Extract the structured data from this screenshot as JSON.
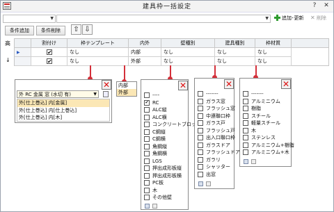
{
  "window": {
    "title": "建具枠一括設定",
    "help": "?",
    "close": "✕"
  },
  "toolbar": {
    "combo1_value": "",
    "combo2_value": "",
    "add_update_label": "追加･更新",
    "delete_label": "削除",
    "add_condition_label": "条件追加",
    "delete_condition_label": "条件削除"
  },
  "grid": {
    "left_labels": [
      "高",
      "↓"
    ],
    "headers": [
      "割付け",
      "枠テンプレート",
      "内外",
      "壁種別",
      "建具種別",
      "枠材質"
    ],
    "rows": [
      {
        "checked": true,
        "template": "なし",
        "inout": "内部",
        "wall": "なし",
        "door": "なし",
        "material": "なし"
      },
      {
        "checked": true,
        "template": "なし",
        "inout": "外部",
        "wall": "なし",
        "door": "なし",
        "material": "なし"
      }
    ]
  },
  "template_panel": {
    "close": "✕",
    "selected": "外 RC 金属 窓 (水切 有)",
    "items": [
      "外[仕上巻込] 内[金属]",
      "外[仕上巻込] 内[仕上巻込]",
      "外[仕上巻込] 内[木]"
    ]
  },
  "inout_panel": {
    "items": [
      "内部",
      "外部"
    ]
  },
  "wall_panel": {
    "close": "✕",
    "items": [
      {
        "label": "----",
        "checked": false
      },
      {
        "label": "RC",
        "checked": true
      },
      {
        "label": "ALC縦",
        "checked": false
      },
      {
        "label": "ALC横",
        "checked": false
      },
      {
        "label": "コンクリートブロック",
        "checked": false
      },
      {
        "label": "C鋼縦",
        "checked": false
      },
      {
        "label": "C鋼横",
        "checked": false
      },
      {
        "label": "角鋼縦",
        "checked": false
      },
      {
        "label": "角鋼横",
        "checked": false
      },
      {
        "label": "LGS",
        "checked": false
      },
      {
        "label": "押出成形板縦",
        "checked": false
      },
      {
        "label": "押出成形板横",
        "checked": false
      },
      {
        "label": "PC板",
        "checked": false
      },
      {
        "label": "木",
        "checked": false
      },
      {
        "label": "その他壁",
        "checked": false
      }
    ]
  },
  "door_panel": {
    "close": "✕",
    "items": [
      "-------",
      "ガラス窓",
      "フラッシュ窓",
      "中連聯口枠",
      "ガラス戸",
      "フラッシュ戸",
      "出入口聯口枠",
      "ガラスドア",
      "フラッシュドア",
      "ガラリ",
      "シャッター",
      "出窓"
    ]
  },
  "material_panel": {
    "close": "✕",
    "items": [
      "-------",
      "アルミニウム",
      "樹脂",
      "スチール",
      "軽量スチール",
      "木",
      "ステンレス",
      "アルミニウム+樹脂",
      "アルミニウム+木"
    ]
  },
  "colors": {
    "connector": "#d4303a",
    "selection": "#fbe7b5",
    "close_x": "#dd1111"
  }
}
